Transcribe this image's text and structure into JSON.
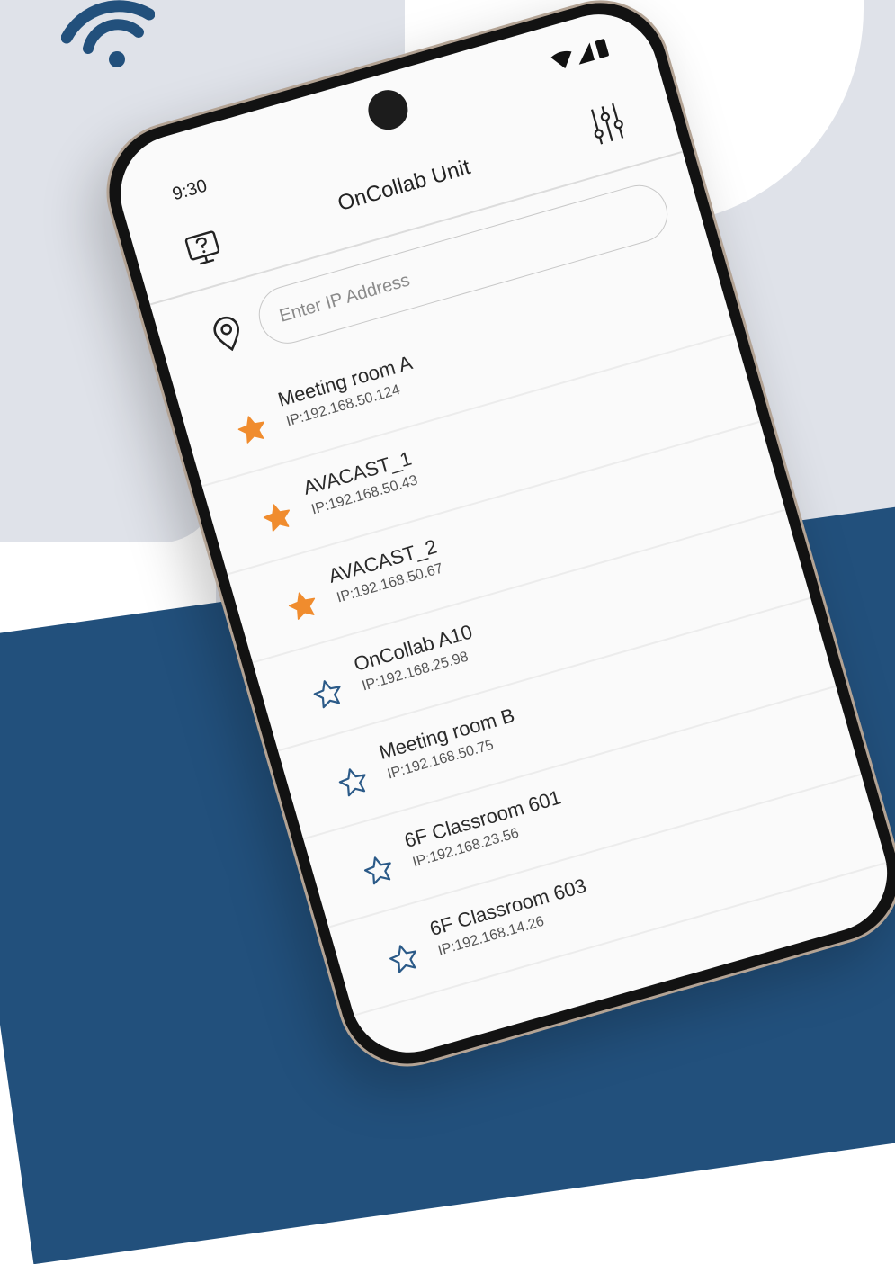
{
  "status_bar": {
    "time": "9:30",
    "icons": [
      "wifi-signal-icon",
      "cell-signal-icon",
      "battery-icon"
    ]
  },
  "header": {
    "title": "OnCollab Unit",
    "left_icon": "help-monitor-icon",
    "right_icon": "settings-sliders-icon"
  },
  "search": {
    "icon": "location-pin-icon",
    "placeholder": "Enter IP Address",
    "value": ""
  },
  "devices": [
    {
      "name": "Meeting room A",
      "ip": "IP:192.168.50.124",
      "favorite": true
    },
    {
      "name": "AVACAST_1",
      "ip": "IP:192.168.50.43",
      "favorite": true
    },
    {
      "name": "AVACAST_2",
      "ip": "IP:192.168.50.67",
      "favorite": true
    },
    {
      "name": "OnCollab A10",
      "ip": "IP:192.168.25.98",
      "favorite": false
    },
    {
      "name": "Meeting room B",
      "ip": "IP:192.168.50.75",
      "favorite": false
    },
    {
      "name": "6F Classroom 601",
      "ip": "IP:192.168.23.56",
      "favorite": false
    },
    {
      "name": "6F Classroom 603",
      "ip": "IP:192.168.14.26",
      "favorite": false
    }
  ],
  "colors": {
    "brand_navy": "#22507c",
    "favorite_star": "#f08c2e",
    "outline_star": "#2b5a88",
    "background_gray": "#dfe2e9"
  }
}
